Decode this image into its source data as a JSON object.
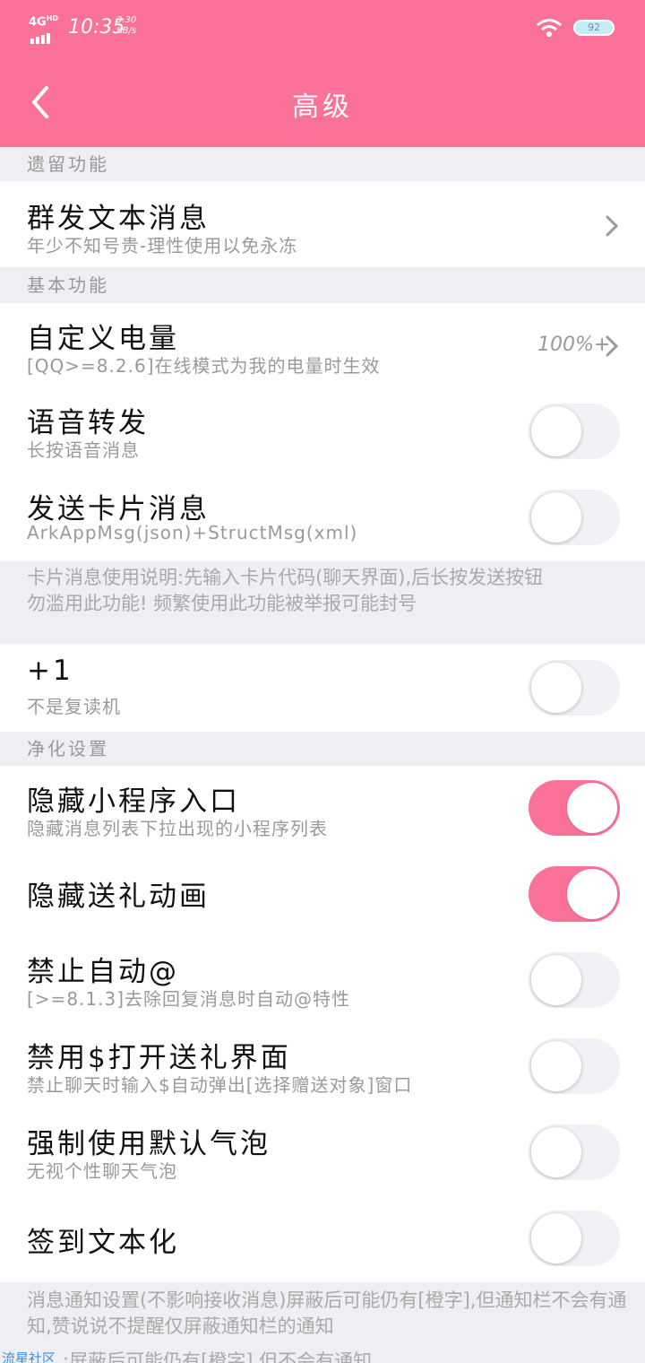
{
  "status": {
    "network": "4G",
    "network_sup": "HD",
    "time": "10:35",
    "speed_value": "3.30",
    "speed_unit": "KB/s",
    "battery": "92"
  },
  "header": {
    "title": "高级"
  },
  "sections": {
    "legacy": "遗留功能",
    "basic": "基本功能",
    "purify": "净化设置"
  },
  "rows": {
    "mass_text": {
      "title": "群发文本消息",
      "subtitle": "年少不知号贵-理性使用以免永冻"
    },
    "battery": {
      "title": "自定义电量",
      "subtitle": "[QQ>=8.2.6]在线模式为我的电量时生效",
      "value": "100%+"
    },
    "voice_forward": {
      "title": "语音转发",
      "subtitle": "长按语音消息",
      "on": false
    },
    "card_msg": {
      "title": "发送卡片消息",
      "subtitle": "ArkAppMsg(json)+StructMsg(xml)",
      "on": false
    },
    "plus_one": {
      "title": "+1",
      "subtitle": "不是复读机",
      "on": false
    },
    "hide_mini": {
      "title": "隐藏小程序入口",
      "subtitle": "隐藏消息列表下拉出现的小程序列表",
      "on": true
    },
    "hide_gift_anim": {
      "title": "隐藏送礼动画",
      "on": true
    },
    "no_auto_at": {
      "title": "禁止自动@",
      "subtitle": "[>=8.1.3]去除回复消息时自动@特性",
      "on": false
    },
    "no_gift_ui": {
      "title": "禁用$打开送礼界面",
      "subtitle": "禁止聊天时输入$自动弹出[选择赠送对象]窗口",
      "on": false
    },
    "default_bubble": {
      "title": "强制使用默认气泡",
      "subtitle": "无视个性聊天气泡",
      "on": false
    },
    "signin_text": {
      "title": "签到文本化",
      "on": false
    }
  },
  "notes": {
    "card_line1": "卡片消息使用说明:先输入卡片代码(聊天界面),后长按发送按钮",
    "card_line2": "勿滥用此功能! 频繁使用此功能被举报可能封号",
    "notify_line1": "消息通知设置(不影响接收消息)屏蔽后可能仍有[橙字],但通知栏不会有通知,赞说说不提醒仅屏蔽通知栏的通知"
  },
  "footer": {
    "brand": "流星社区",
    "text": ":屏蔽后可能仍有[橙字],但不会有通知"
  },
  "colors": {
    "accent": "#fb7299",
    "background": "#eeeef3"
  }
}
